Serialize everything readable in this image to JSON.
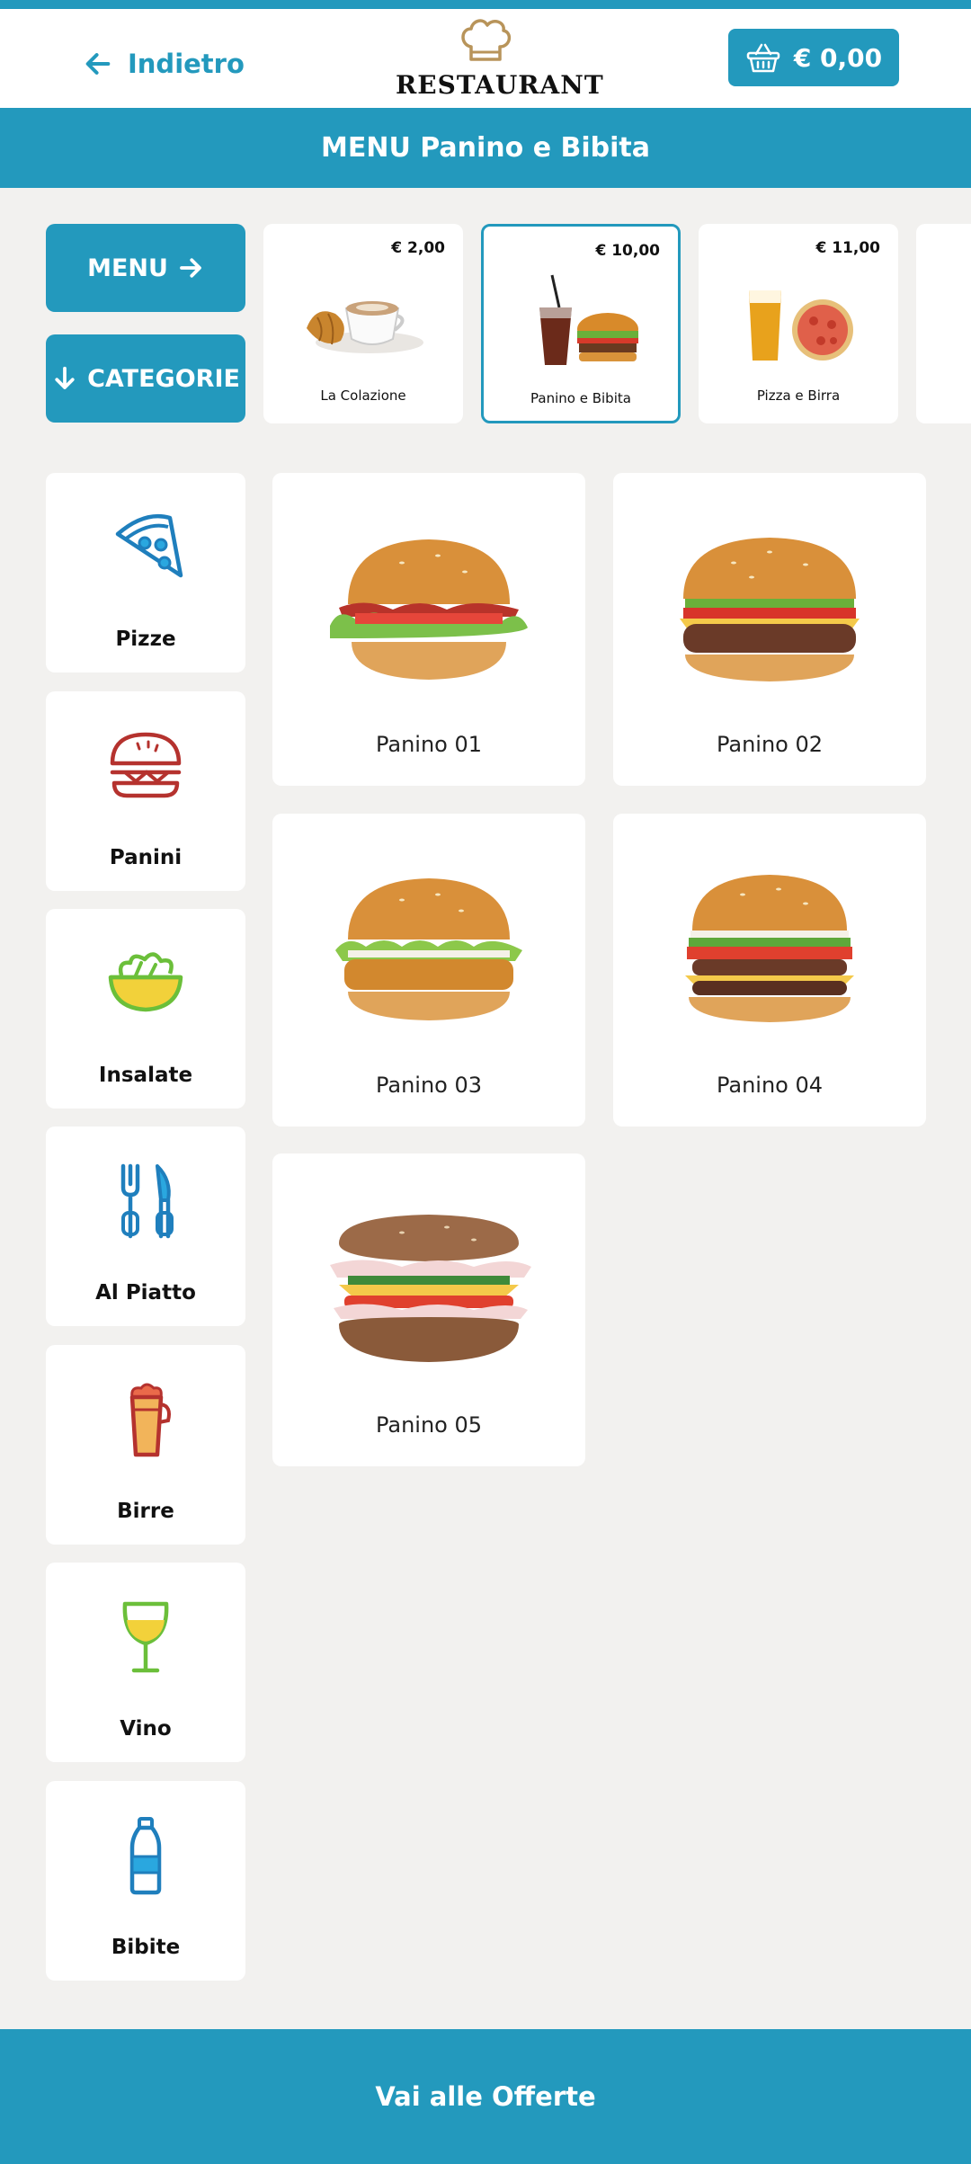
{
  "header": {
    "back_label": "Indietro",
    "logo_text": "RESTAURANT",
    "cart_total": "€ 0,00"
  },
  "title": "MENU Panino e Bibita",
  "nav": {
    "menu_label": "MENU",
    "categories_label": "CATEGORIE"
  },
  "menus": [
    {
      "price": "€ 2,00",
      "name": "La Colazione",
      "selected": false
    },
    {
      "price": "€ 10,00",
      "name": "Panino e Bibita",
      "selected": true
    },
    {
      "price": "€ 11,00",
      "name": "Pizza e Birra",
      "selected": false
    }
  ],
  "categories": [
    {
      "label": "Pizze",
      "icon": "pizza-icon"
    },
    {
      "label": "Panini",
      "icon": "burger-icon"
    },
    {
      "label": "Insalate",
      "icon": "salad-icon"
    },
    {
      "label": "Al Piatto",
      "icon": "cutlery-icon"
    },
    {
      "label": "Birre",
      "icon": "beer-icon"
    },
    {
      "label": "Vino",
      "icon": "wine-glass-icon"
    },
    {
      "label": "Bibite",
      "icon": "bottle-icon"
    }
  ],
  "products": [
    {
      "name": "Panino 01"
    },
    {
      "name": "Panino 02"
    },
    {
      "name": "Panino 03"
    },
    {
      "name": "Panino 04"
    },
    {
      "name": "Panino 05"
    }
  ],
  "footer": {
    "offers_label": "Vai alle Offerte"
  },
  "colors": {
    "accent": "#2399bd",
    "background": "#f2f1ef",
    "card": "#ffffff"
  }
}
